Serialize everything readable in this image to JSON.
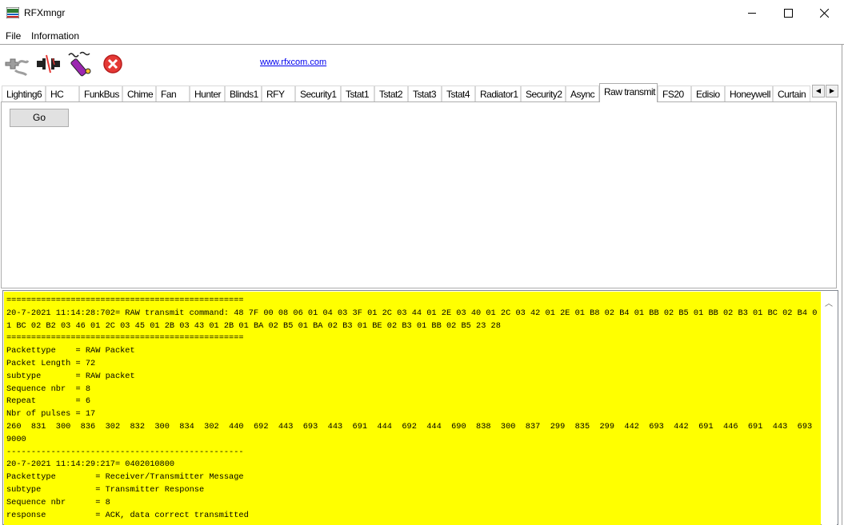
{
  "window": {
    "title": "RFXmngr"
  },
  "menu": [
    "File",
    "Information"
  ],
  "toolbar": {
    "icons": [
      "plug-icon",
      "disconnect-icon",
      "transmitter-icon",
      "stop-icon"
    ],
    "link": "www.rfxcom.com"
  },
  "tabs": [
    {
      "label": "Lighting6"
    },
    {
      "label": "HC"
    },
    {
      "label": "FunkBus"
    },
    {
      "label": "Chime"
    },
    {
      "label": "Fan"
    },
    {
      "label": "Hunter"
    },
    {
      "label": "Blinds1"
    },
    {
      "label": "RFY"
    },
    {
      "label": "Security1"
    },
    {
      "label": "Tstat1"
    },
    {
      "label": "Tstat2"
    },
    {
      "label": "Tstat3"
    },
    {
      "label": "Tstat4"
    },
    {
      "label": "Radiator1"
    },
    {
      "label": "Security2"
    },
    {
      "label": "Async"
    },
    {
      "label": "Raw transmit"
    },
    {
      "label": "FS20"
    },
    {
      "label": "Edisio"
    },
    {
      "label": "Honeywell"
    },
    {
      "label": "Curtain"
    }
  ],
  "selected_tab": "Raw transmit",
  "panel": {
    "go_label": "Go"
  },
  "colors": {
    "log_background": "#ffff00"
  },
  "log": {
    "lines": [
      "================================================",
      "20-7-2021 11:14:28:702= RAW transmit command: 48 7F 00 08 06 01 04 03 3F 01 2C 03 44 01 2E 03 40 01 2C 03 42 01 2E 01 B8 02 B4 01 BB 02 B5 01 BB 02 B3 01 BC 02 B4 01 BC 02 B2 03 46 01 2C 03 45 01 2B 03 43 01 2B 01 BA 02 B5 01 BA 02 B3 01 BE 02 B3 01 BB 02 B5 23 28",
      "================================================",
      "Packettype    = RAW Packet",
      "Packet Length = 72",
      "subtype       = RAW packet",
      "Sequence nbr  = 8",
      "Repeat        = 6",
      "Nbr of pulses = 17",
      "260  831  300  836  302  832  300  834  302  440  692  443  693  443  691  444  692  444  690  838  300  837  299  835  299  442  693  442  691  446  691  443  693  9000",
      "------------------------------------------------",
      "20-7-2021 11:14:29:217= 0402010800",
      "Packettype        = Receiver/Transmitter Message",
      "subtype           = Transmitter Response",
      "Sequence nbr      = 8",
      "response          = ACK, data correct transmitted"
    ]
  }
}
